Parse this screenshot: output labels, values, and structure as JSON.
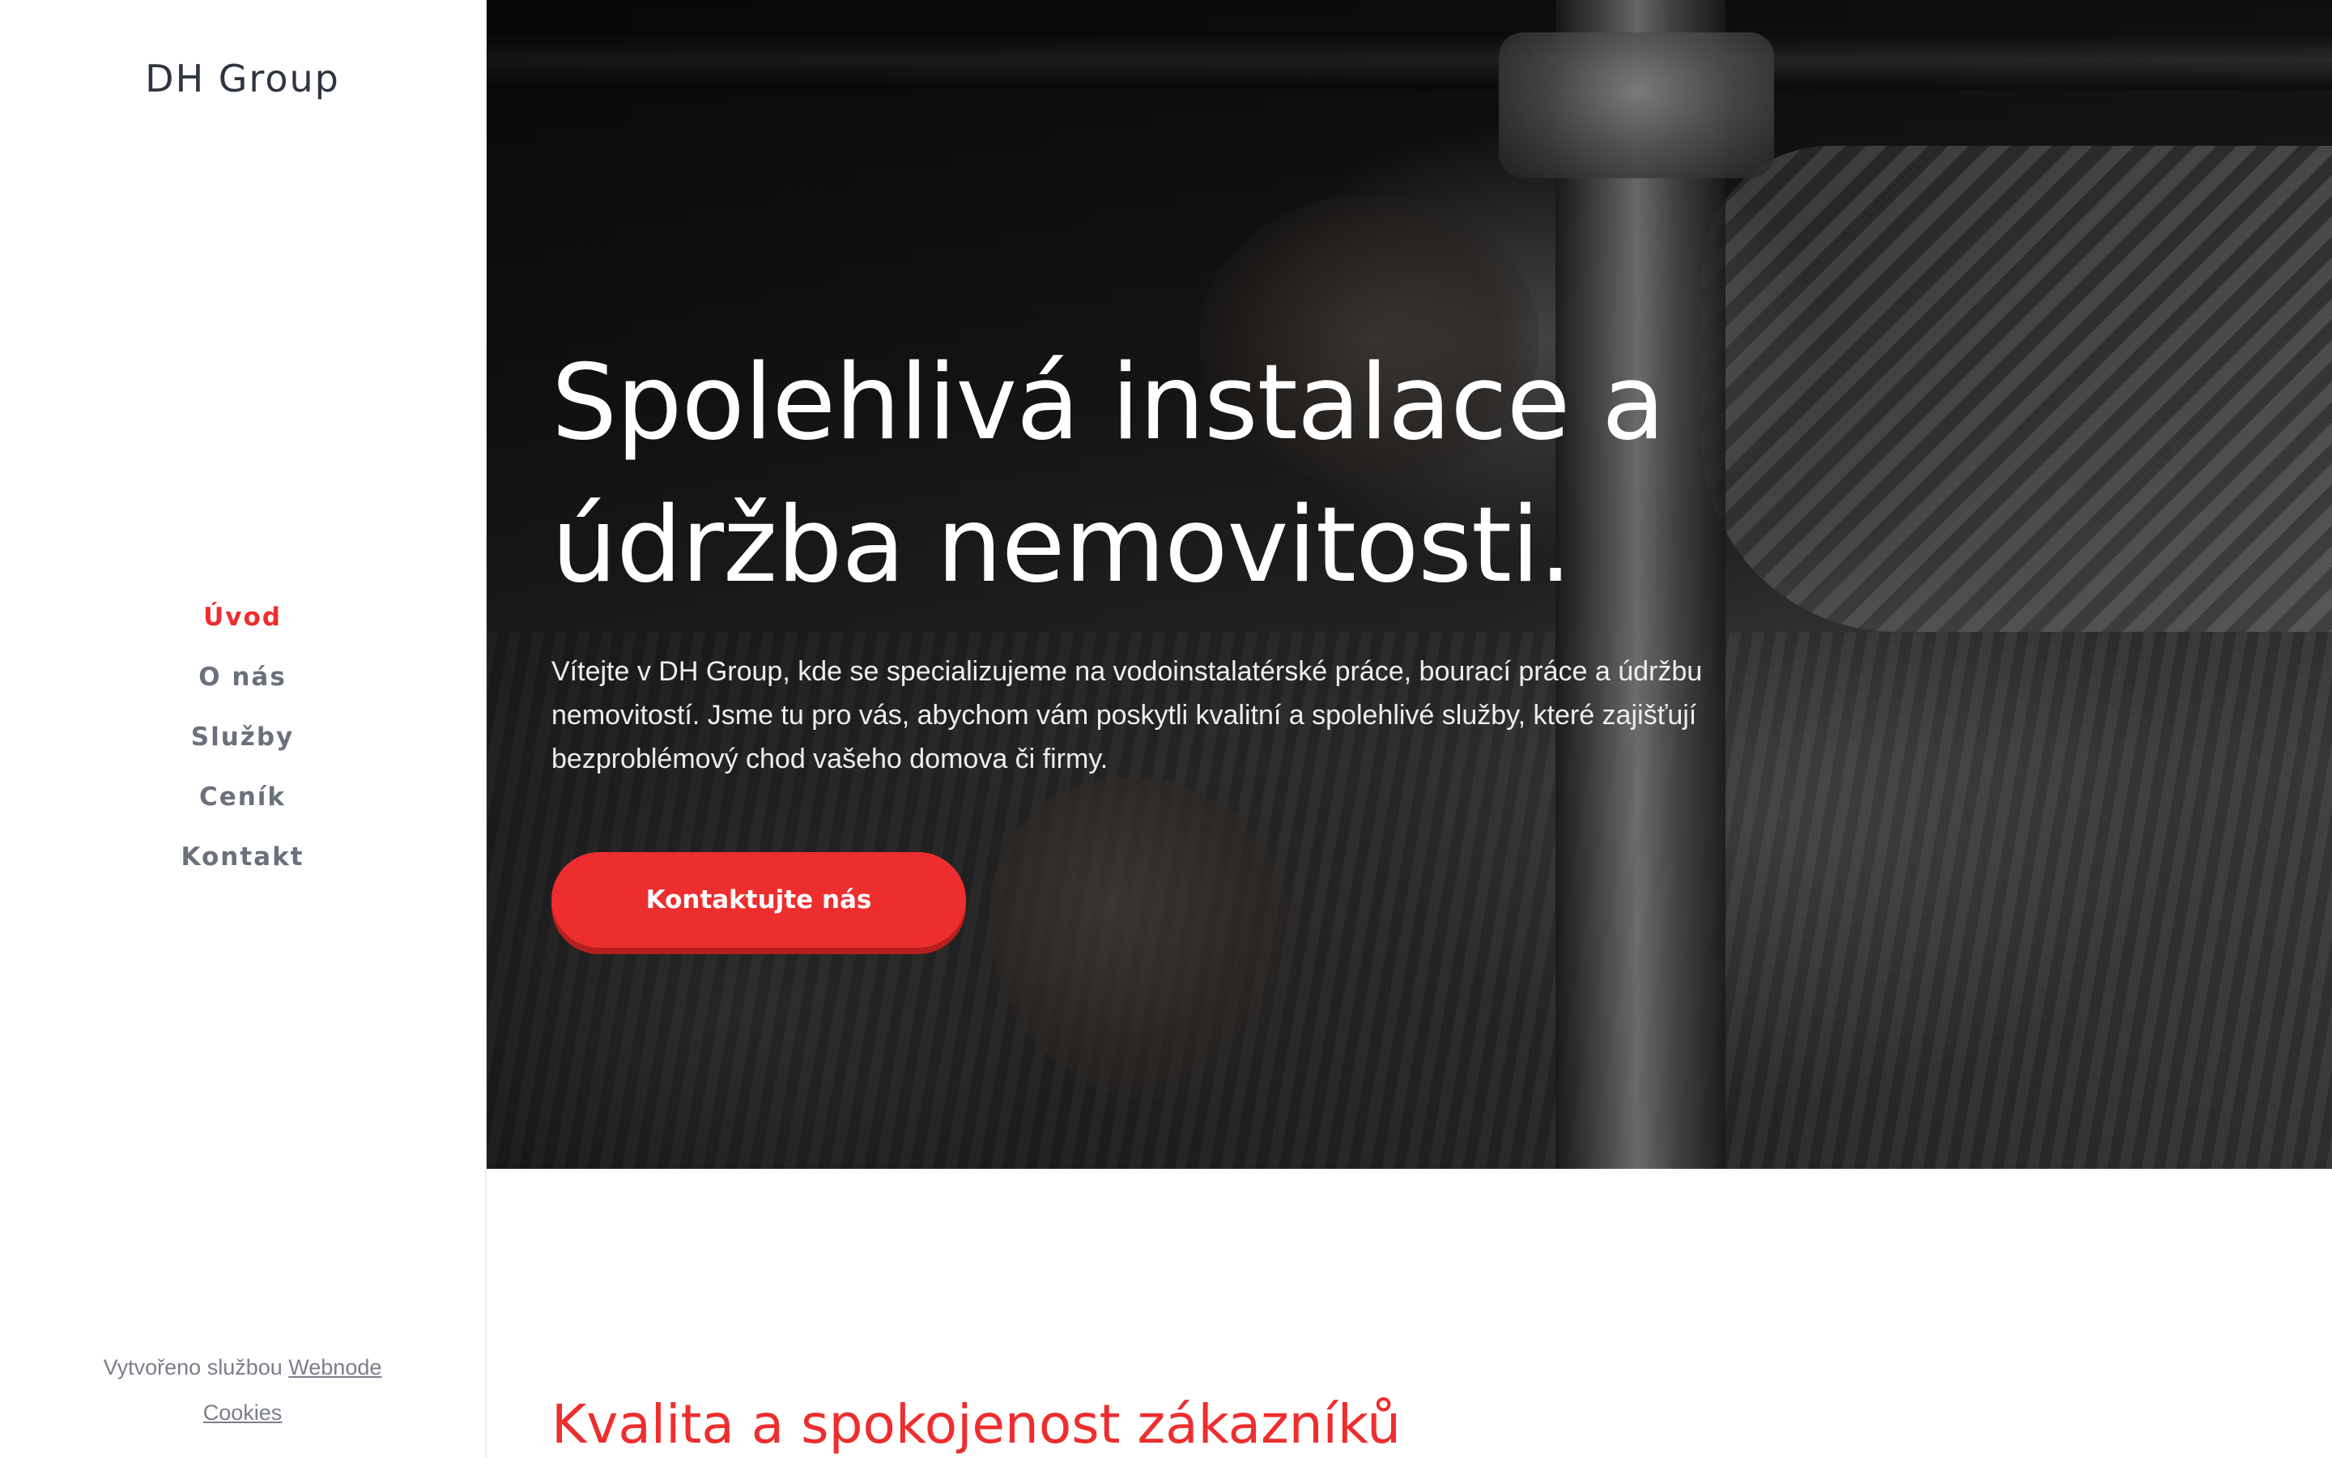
{
  "brand": {
    "name": "DH Group"
  },
  "nav": {
    "items": [
      {
        "label": "Úvod",
        "active": true
      },
      {
        "label": "O nás",
        "active": false
      },
      {
        "label": "Služby",
        "active": false
      },
      {
        "label": "Ceník",
        "active": false
      },
      {
        "label": "Kontakt",
        "active": false
      }
    ]
  },
  "footer": {
    "created_prefix": "Vytvořeno službou",
    "created_link": "Webnode",
    "cookies": "Cookies"
  },
  "hero": {
    "title_line1": "Spolehlivá instalace a",
    "title_line2": "údržba nemovitosti.",
    "text": "Vítejte v DH Group, kde se specializujeme na vodoinstalatérské práce, bourací práce a údržbu nemovitostí. Jsme tu pro vás, abychom vám poskytli kvalitní a spolehlivé služby, které zajišťují bezproblémový chod vašeho domova či firmy.",
    "cta_label": "Kontaktujte nás"
  },
  "section": {
    "title": "Kvalita a spokojenost zákazníků"
  },
  "colors": {
    "accent": "#ee2e2e",
    "nav_text": "#6b717c",
    "logo_text": "#2f3540"
  }
}
